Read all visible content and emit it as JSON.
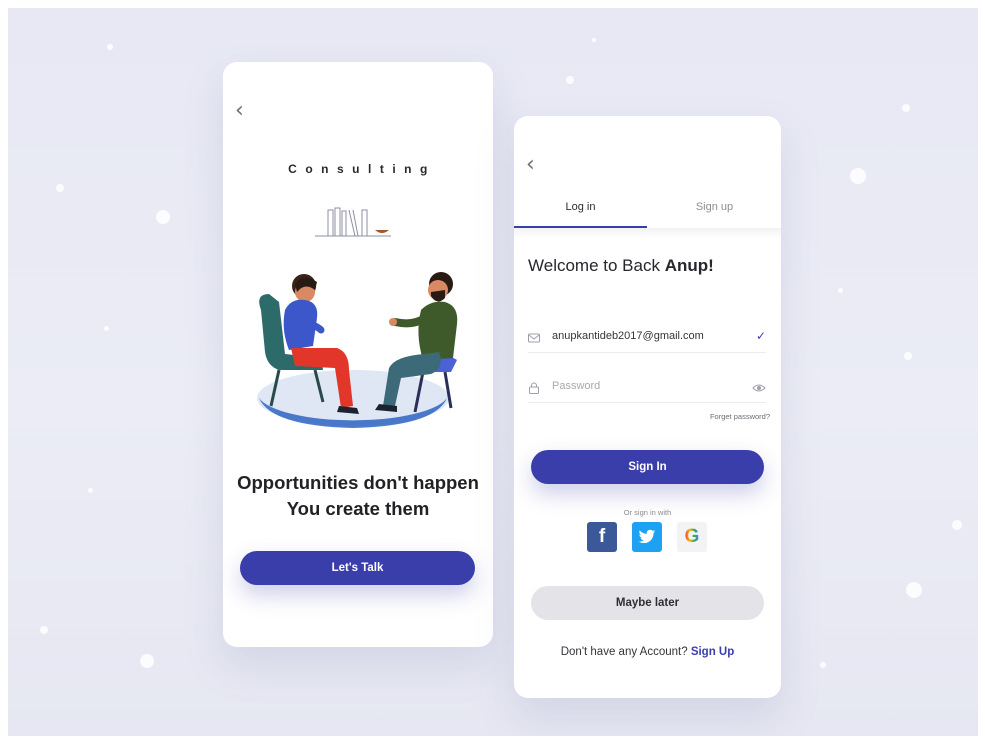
{
  "colors": {
    "accent": "#3a3eab",
    "background": "#e9eaf4",
    "card": "#ffffff",
    "facebook": "#3b5998",
    "twitter": "#1da1f2"
  },
  "left_screen": {
    "back_icon": "chevron-left-icon",
    "title": "Consulting",
    "headline_line1": "Opportunities don't happen",
    "headline_line2": "You create them",
    "cta_label": "Let's Talk"
  },
  "right_screen": {
    "back_icon": "chevron-left-icon",
    "tabs": [
      {
        "label": "Log in",
        "active": true
      },
      {
        "label": "Sign up",
        "active": false
      }
    ],
    "welcome_prefix": "Welcome to Back",
    "welcome_name": "Anup!",
    "email": {
      "icon": "mail-icon",
      "value": "anupkantideb2017@gmail.com",
      "status_icon": "check-icon",
      "status_glyph": "✓"
    },
    "password": {
      "icon": "lock-icon",
      "placeholder": "Password",
      "toggle_icon": "eye-icon"
    },
    "forgot_label": "Forget password?",
    "sign_in_label": "Sign In",
    "or_label": "Or sign in with",
    "social": [
      {
        "name": "facebook",
        "icon": "facebook-icon",
        "glyph": "f"
      },
      {
        "name": "twitter",
        "icon": "twitter-icon"
      },
      {
        "name": "google",
        "icon": "google-icon",
        "glyph": "G"
      }
    ],
    "maybe_later_label": "Maybe later",
    "no_account_text": "Don't have any Account?",
    "sign_up_link": "Sign Up"
  }
}
